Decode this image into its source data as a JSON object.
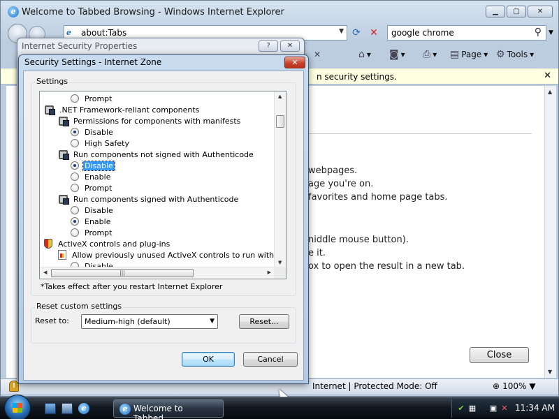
{
  "browser": {
    "title": "Welcome to Tabbed Browsing - Windows Internet Explorer",
    "address": "about:Tabs",
    "search_value": "google chrome",
    "commands": {
      "page": "Page",
      "tools": "Tools"
    },
    "infobar_text": "n security settings.",
    "content_lines": [
      "webpages.",
      "age you're on.",
      "favorites and home page tabs.",
      "niddle mouse button).",
      "e it.",
      "ox to open the result in a new tab."
    ],
    "close_button": "Close",
    "status": {
      "zone": "Internet | Protected Mode: Off",
      "zoom": "100%"
    }
  },
  "back_dialog": {
    "title": "Internet Security Properties",
    "help_glyph": "?",
    "close_glyph": "✕"
  },
  "dialog": {
    "title": "Security Settings - Internet Zone",
    "close_glyph": "✕",
    "settings_group_label": "Settings",
    "tree": [
      {
        "kind": "radio",
        "indent": 2,
        "checked": false,
        "selected": false,
        "label": "Prompt"
      },
      {
        "kind": "gear",
        "indent": 0,
        "label": ".NET Framework-reliant components"
      },
      {
        "kind": "gear",
        "indent": 1,
        "label": "Permissions for components with manifests"
      },
      {
        "kind": "radio",
        "indent": 2,
        "checked": true,
        "selected": false,
        "label": "Disable"
      },
      {
        "kind": "radio",
        "indent": 2,
        "checked": false,
        "selected": false,
        "label": "High Safety"
      },
      {
        "kind": "gear",
        "indent": 1,
        "label": "Run components not signed with Authenticode"
      },
      {
        "kind": "radio",
        "indent": 2,
        "checked": true,
        "selected": true,
        "label": "Disable"
      },
      {
        "kind": "radio",
        "indent": 2,
        "checked": false,
        "selected": false,
        "label": "Enable"
      },
      {
        "kind": "radio",
        "indent": 2,
        "checked": false,
        "selected": false,
        "label": "Prompt"
      },
      {
        "kind": "gear",
        "indent": 1,
        "label": "Run components signed with Authenticode"
      },
      {
        "kind": "radio",
        "indent": 2,
        "checked": false,
        "selected": false,
        "label": "Disable"
      },
      {
        "kind": "radio",
        "indent": 2,
        "checked": true,
        "selected": false,
        "label": "Enable"
      },
      {
        "kind": "radio",
        "indent": 2,
        "checked": false,
        "selected": false,
        "label": "Prompt"
      },
      {
        "kind": "shield",
        "indent": 0,
        "label": "ActiveX controls and plug-ins"
      },
      {
        "kind": "page",
        "indent": 1,
        "label": "Allow previously unused ActiveX controls to run without prom"
      },
      {
        "kind": "radio",
        "indent": 2,
        "checked": false,
        "selected": false,
        "label": "Disable"
      }
    ],
    "note": "*Takes effect after you restart Internet Explorer",
    "reset_group_label": "Reset custom settings",
    "reset_to_label": "Reset to:",
    "reset_select_value": "Medium-high (default)",
    "reset_button": "Reset...",
    "ok_button": "OK",
    "cancel_button": "Cancel"
  },
  "taskbar": {
    "active_window": "Welcome to Tabbed...",
    "clock": "11:34 AM"
  }
}
